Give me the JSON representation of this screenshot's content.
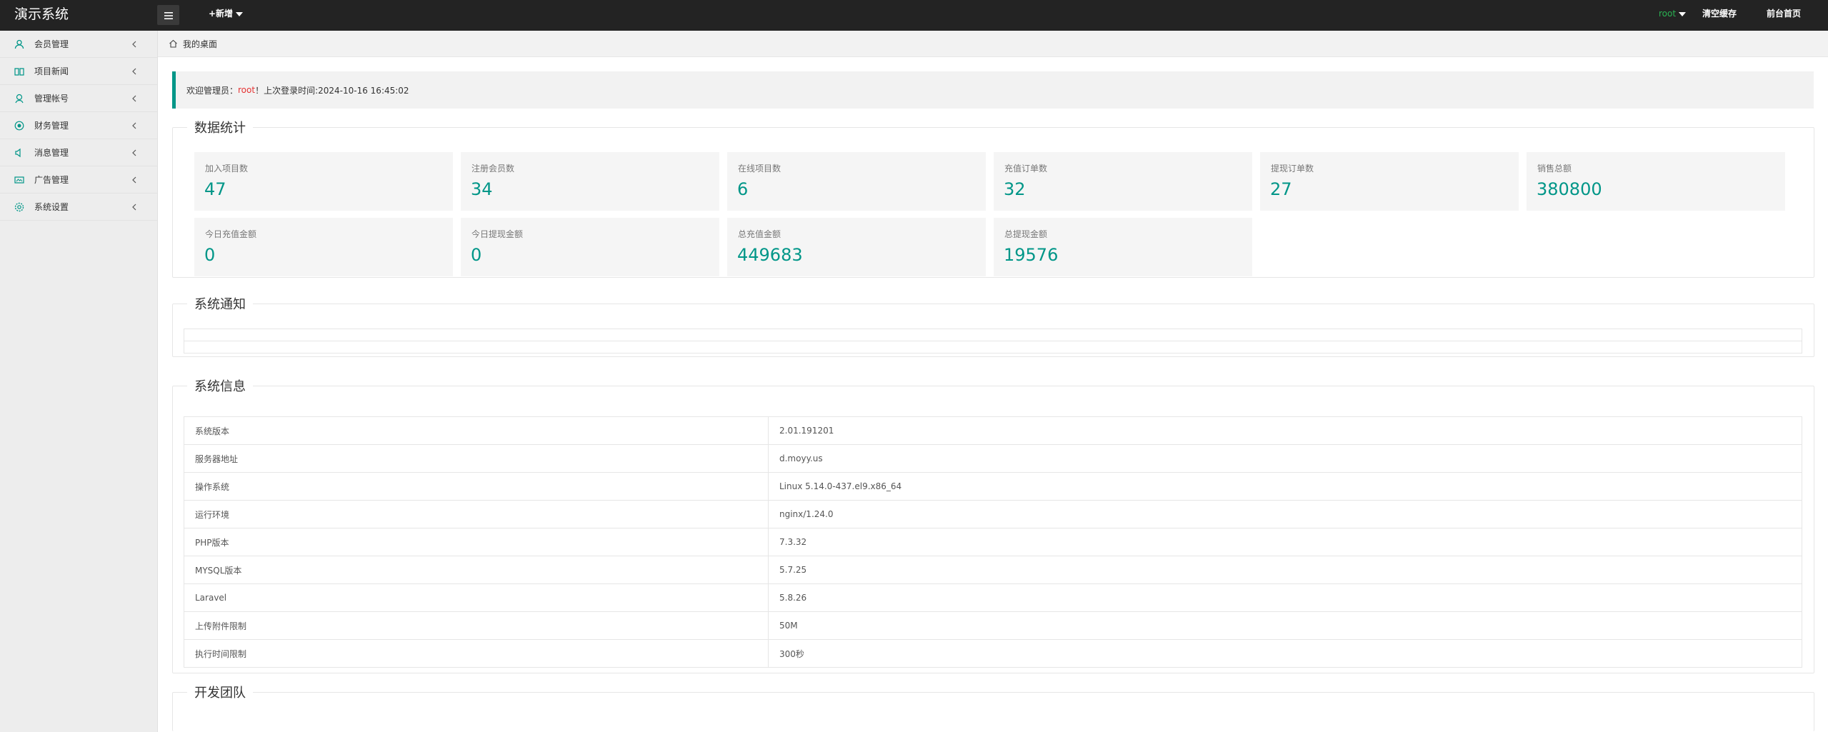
{
  "header": {
    "brand": "演示系统",
    "add_label": "+新增",
    "user": "root",
    "clear_cache": "清空缓存",
    "frontend_home": "前台首页"
  },
  "sidebar": {
    "items": [
      {
        "label": "会员管理",
        "icon": "user-icon"
      },
      {
        "label": "项目新闻",
        "icon": "book-icon"
      },
      {
        "label": "管理帐号",
        "icon": "user-admin-icon"
      },
      {
        "label": "财务管理",
        "icon": "finance-icon"
      },
      {
        "label": "消息管理",
        "icon": "message-icon"
      },
      {
        "label": "广告管理",
        "icon": "ad-icon"
      },
      {
        "label": "系统设置",
        "icon": "settings-icon"
      }
    ]
  },
  "breadcrumb": {
    "label": "我的桌面"
  },
  "welcome": {
    "prefix": "欢迎管理员：",
    "user": "root",
    "suffix": "！上次登录时间:2024-10-16 16:45:02"
  },
  "stats": {
    "title": "数据统计",
    "items": [
      {
        "label": "加入项目数",
        "value": "47"
      },
      {
        "label": "注册会员数",
        "value": "34"
      },
      {
        "label": "在线项目数",
        "value": "6"
      },
      {
        "label": "充值订单数",
        "value": "32"
      },
      {
        "label": "提现订单数",
        "value": "27"
      },
      {
        "label": "销售总额",
        "value": "380800"
      },
      {
        "label": "今日充值金额",
        "value": "0"
      },
      {
        "label": "今日提现金额",
        "value": "0"
      },
      {
        "label": "总充值金额",
        "value": "449683"
      },
      {
        "label": "总提现金额",
        "value": "19576"
      }
    ]
  },
  "notice": {
    "title": "系统通知"
  },
  "sysinfo": {
    "title": "系统信息",
    "rows": [
      {
        "key": "系统版本",
        "value": "2.01.191201"
      },
      {
        "key": "服务器地址",
        "value": "d.moyy.us"
      },
      {
        "key": "操作系统",
        "value": "Linux 5.14.0-437.el9.x86_64"
      },
      {
        "key": "运行环境",
        "value": "nginx/1.24.0"
      },
      {
        "key": "PHP版本",
        "value": "7.3.32"
      },
      {
        "key": "MYSQL版本",
        "value": "5.7.25"
      },
      {
        "key": "Laravel",
        "value": "5.8.26"
      },
      {
        "key": "上传附件限制",
        "value": "50M"
      },
      {
        "key": "执行时间限制",
        "value": "300秒"
      }
    ]
  },
  "team": {
    "title": "开发团队"
  },
  "colors": {
    "accent": "#009688",
    "topbar": "#232323",
    "user_green": "#2ab352",
    "welcome_red": "#e53333"
  }
}
